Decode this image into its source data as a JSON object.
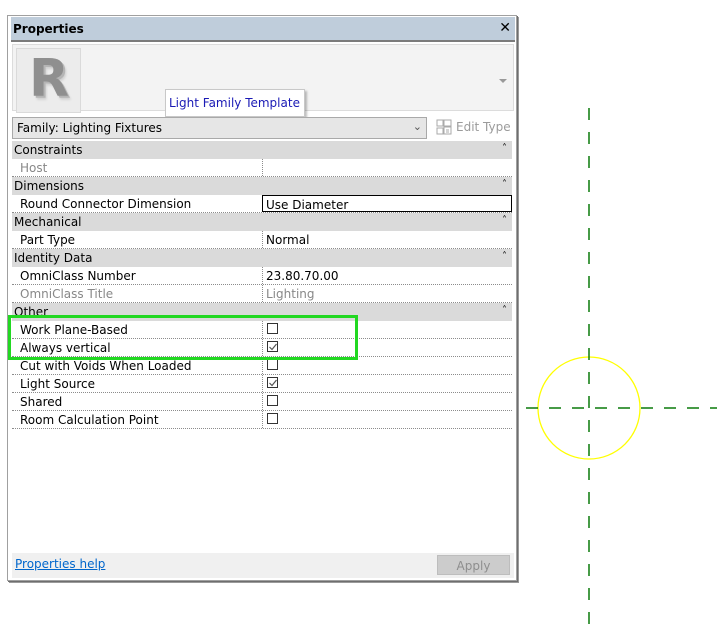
{
  "panel": {
    "title": "Properties",
    "close_icon": "close-icon",
    "type_tooltip": "Light Family Template",
    "family_selector": "Family: Lighting Fixtures",
    "edit_type_label": "Edit Type"
  },
  "categories": [
    {
      "name": "Constraints",
      "rows": [
        {
          "name": "Host",
          "value": "",
          "greyed": true
        }
      ]
    },
    {
      "name": "Dimensions",
      "rows": [
        {
          "name": "Round Connector Dimension",
          "value": "Use Diameter",
          "selected": true
        }
      ]
    },
    {
      "name": "Mechanical",
      "rows": [
        {
          "name": "Part Type",
          "value": "Normal"
        }
      ]
    },
    {
      "name": "Identity Data",
      "rows": [
        {
          "name": "OmniClass Number",
          "value": "23.80.70.00"
        },
        {
          "name": "OmniClass Title",
          "value": "Lighting",
          "greyed": true
        }
      ]
    },
    {
      "name": "Other",
      "rows": [
        {
          "name": "Work Plane-Based",
          "checkbox": true,
          "checked": false
        },
        {
          "name": "Always vertical",
          "checkbox": true,
          "checked": true
        },
        {
          "name": "Cut with Voids When Loaded",
          "checkbox": true,
          "checked": false
        },
        {
          "name": "Light Source",
          "checkbox": true,
          "checked": true
        },
        {
          "name": "Shared",
          "checkbox": true,
          "checked": false
        },
        {
          "name": "Room Calculation Point",
          "checkbox": true,
          "checked": false
        }
      ]
    }
  ],
  "footer": {
    "help_link": "Properties help",
    "apply_label": "Apply"
  },
  "colors": {
    "titlebar": "#bfcddb",
    "highlight": "#22d822",
    "reference_lines": "#0a7a0a",
    "light_source_circle": "#ffff00"
  }
}
